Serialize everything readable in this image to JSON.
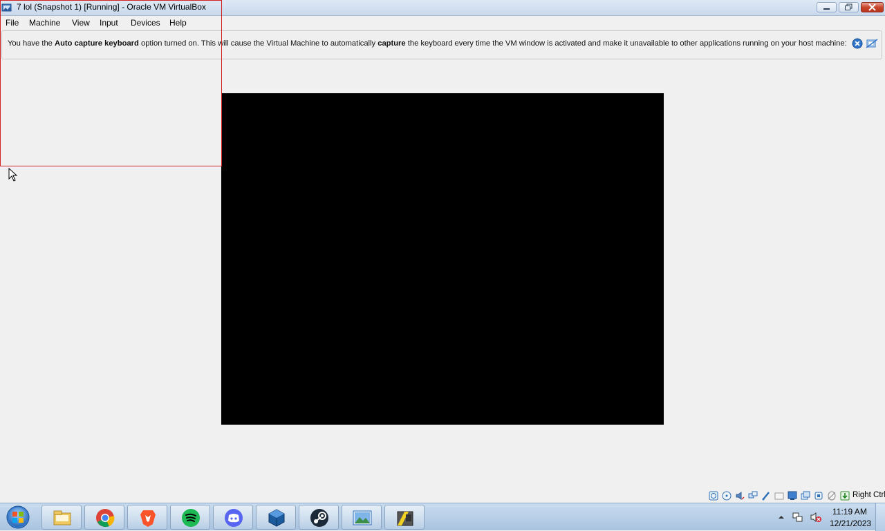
{
  "window": {
    "title": "7 lol (Snapshot 1) [Running] - Oracle VM VirtualBox",
    "icon": "virtualbox-icon",
    "controls": [
      "minimize-icon",
      "maximize-icon",
      "close-icon"
    ]
  },
  "menu": {
    "file": "File",
    "machine": "Machine",
    "view": "View",
    "input": "Input",
    "devices": "Devices",
    "help": "Help"
  },
  "notice": {
    "part1": "You have the ",
    "bold1": "Auto capture keyboard",
    "part2": " option turned on. This will cause the Virtual Machine to automatically ",
    "bold2": "capture",
    "part3": " the keyboard every time the VM window is activated and make it unavailable to other applications running on your host machine:",
    "close_icon": "close-notice-icon",
    "hide_icon": "hide-notice-icon"
  },
  "statusbar": {
    "icons": [
      "hard-disk-icon",
      "optical-drive-icon",
      "audio-icon",
      "network-icon",
      "usb-icon",
      "shared-folders-icon",
      "display-icon",
      "video-capture-icon",
      "cpu-icon",
      "mouse-integration-icon",
      "keyboard-capture-icon"
    ],
    "host_key": "Right Ctrl"
  },
  "taskbar": {
    "apps": [
      "explorer-icon",
      "chrome-icon",
      "brave-icon",
      "spotify-icon",
      "discord-icon",
      "virtualbox-icon",
      "steam-icon",
      "photos-icon",
      "app-icon"
    ],
    "clock": {
      "time": "11:19 AM",
      "date": "12/21/2023"
    }
  },
  "colors": {
    "vm_screen": "#000000",
    "selection_rect": "#d02020",
    "background": "#f0f0f0"
  }
}
